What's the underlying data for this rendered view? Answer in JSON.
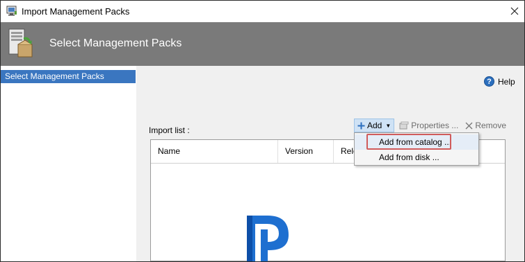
{
  "window": {
    "title": "Import Management Packs",
    "close_icon": "close-icon",
    "app_icon": "management-pack-icon"
  },
  "header": {
    "title": "Select Management Packs",
    "icon": "management-pack-wizard-icon"
  },
  "nav": {
    "items": [
      {
        "label": "Select Management Packs",
        "selected": true
      }
    ]
  },
  "help": {
    "label": "Help",
    "icon": "help-icon"
  },
  "import_list": {
    "label": "Import list :",
    "columns": [
      {
        "label": "Name"
      },
      {
        "label": "Version"
      },
      {
        "label": "Rele"
      }
    ]
  },
  "toolbar": {
    "add_label": "Add",
    "properties_label": "Properties ...",
    "remove_label": "Remove"
  },
  "add_menu": {
    "items": [
      {
        "label": "Add from catalog ..."
      },
      {
        "label": "Add from disk ..."
      }
    ]
  },
  "colors": {
    "header_bg": "#7a7a7a",
    "selection": "#3a76c0",
    "highlight_box": "#d05b5b",
    "add_button_bg": "#cfe2f5"
  }
}
